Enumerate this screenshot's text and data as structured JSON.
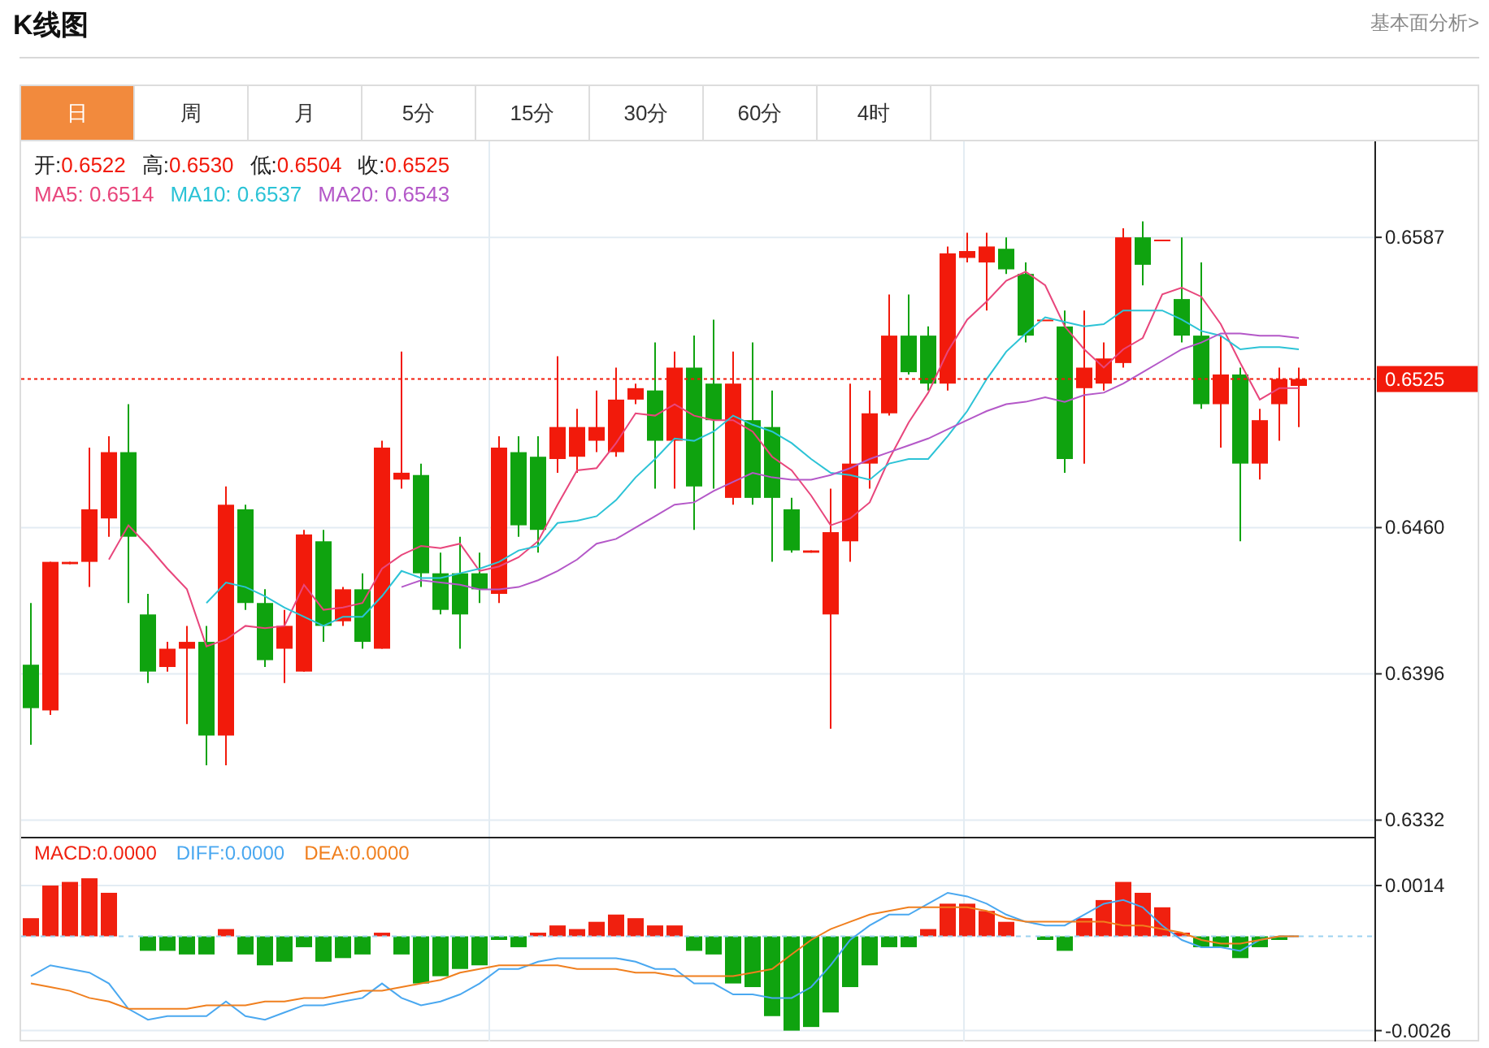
{
  "header": {
    "title": "K线图",
    "link": "基本面分析>"
  },
  "tabs": [
    {
      "label": "日",
      "selected": true
    },
    {
      "label": "周",
      "selected": false
    },
    {
      "label": "月",
      "selected": false
    },
    {
      "label": "5分",
      "selected": false
    },
    {
      "label": "15分",
      "selected": false
    },
    {
      "label": "30分",
      "selected": false
    },
    {
      "label": "60分",
      "selected": false
    },
    {
      "label": "4时",
      "selected": false
    }
  ],
  "ohlc_legend": [
    {
      "label": "开:",
      "value": "0.6522"
    },
    {
      "label": "高:",
      "value": "0.6530"
    },
    {
      "label": "低:",
      "value": "0.6504"
    },
    {
      "label": "收:",
      "value": "0.6525"
    }
  ],
  "ma_legend": [
    {
      "label": "MA5: 0.6514",
      "color": "#e8467c"
    },
    {
      "label": "MA10: 0.6537",
      "color": "#2cc3d6"
    },
    {
      "label": "MA20: 0.6543",
      "color": "#b458c8"
    }
  ],
  "price_chart": {
    "chart_data": {
      "type": "candlestick",
      "grid": true,
      "ylim": [
        0.6324,
        0.6629
      ],
      "yticks": [
        0.6332,
        0.6396,
        {
          "value": 0.646,
          "label": "0.6460"
        },
        0.6587
      ],
      "categories": [
        null,
        null,
        null,
        null,
        null,
        null,
        null,
        null,
        null,
        null,
        null,
        null,
        null,
        null,
        null,
        null,
        null,
        null,
        null,
        null,
        null,
        null,
        null,
        null,
        null,
        null,
        null,
        null,
        null,
        null,
        null,
        null,
        null,
        null,
        null,
        null,
        null,
        null,
        null,
        null,
        null,
        null,
        null,
        null,
        null,
        null,
        null,
        null,
        null,
        null,
        null,
        null,
        null,
        null,
        null,
        null,
        null,
        null,
        null,
        null,
        null,
        null,
        null,
        null,
        null,
        null
      ],
      "ref_lines": [
        {
          "axis": "y",
          "value": 0.6525,
          "label": "0.6525"
        }
      ],
      "ohlc": [
        [
          0.64,
          0.6427,
          0.6365,
          0.6381
        ],
        [
          0.638,
          0.6445,
          0.6378,
          0.6445
        ],
        [
          0.6444,
          0.6445,
          0.6444,
          0.6445
        ],
        [
          0.6445,
          0.6495,
          0.6434,
          0.6468
        ],
        [
          0.6464,
          0.65,
          0.6456,
          0.6493
        ],
        [
          0.6493,
          0.6514,
          0.6427,
          0.6456
        ],
        [
          0.6422,
          0.6431,
          0.6392,
          0.6397
        ],
        [
          0.6399,
          0.641,
          0.6397,
          0.6407
        ],
        [
          0.6407,
          0.6417,
          0.6374,
          0.641
        ],
        [
          0.641,
          0.6417,
          0.6356,
          0.6369
        ],
        [
          0.6369,
          0.6478,
          0.6356,
          0.647
        ],
        [
          0.6468,
          0.647,
          0.6424,
          0.6427
        ],
        [
          0.6427,
          0.6433,
          0.6399,
          0.6402
        ],
        [
          0.6407,
          0.6424,
          0.6392,
          0.6417
        ],
        [
          0.6397,
          0.6459,
          0.6397,
          0.6457
        ],
        [
          0.6454,
          0.6459,
          0.641,
          0.6417
        ],
        [
          0.6419,
          0.6434,
          0.6417,
          0.6433
        ],
        [
          0.6433,
          0.644,
          0.6407,
          0.641
        ],
        [
          0.6407,
          0.6498,
          0.6407,
          0.6495
        ],
        [
          0.6481,
          0.6537,
          0.6477,
          0.6484
        ],
        [
          0.6483,
          0.6488,
          0.6434,
          0.644
        ],
        [
          0.644,
          0.6449,
          0.6422,
          0.6424
        ],
        [
          0.644,
          0.6456,
          0.6407,
          0.6422
        ],
        [
          0.644,
          0.6449,
          0.6427,
          0.6433
        ],
        [
          0.6431,
          0.65,
          0.6427,
          0.6495
        ],
        [
          0.6493,
          0.65,
          0.6456,
          0.6461
        ],
        [
          0.6491,
          0.65,
          0.6449,
          0.6459
        ],
        [
          0.649,
          0.6535,
          0.6484,
          0.6504
        ],
        [
          0.6491,
          0.6512,
          0.6484,
          0.6504
        ],
        [
          0.6498,
          0.652,
          0.6493,
          0.6504
        ],
        [
          0.6493,
          0.653,
          0.6491,
          0.6516
        ],
        [
          0.6516,
          0.6523,
          0.6514,
          0.6521
        ],
        [
          0.652,
          0.6541,
          0.6477,
          0.6498
        ],
        [
          0.6498,
          0.6537,
          0.6477,
          0.653
        ],
        [
          0.653,
          0.6544,
          0.6459,
          0.6478
        ],
        [
          0.6523,
          0.6551,
          0.6477,
          0.6507
        ],
        [
          0.6473,
          0.6537,
          0.647,
          0.6523
        ],
        [
          0.6507,
          0.6541,
          0.647,
          0.6473
        ],
        [
          0.6504,
          0.652,
          0.6445,
          0.6473
        ],
        [
          0.6468,
          0.6473,
          0.6449,
          0.645
        ],
        [
          0.6449,
          0.645,
          0.6449,
          0.645
        ],
        [
          0.6422,
          0.6477,
          0.6372,
          0.6458
        ],
        [
          0.6454,
          0.6523,
          0.6445,
          0.6488
        ],
        [
          0.6488,
          0.652,
          0.6477,
          0.651
        ],
        [
          0.651,
          0.6562,
          0.6509,
          0.6544
        ],
        [
          0.6544,
          0.6562,
          0.6527,
          0.6528
        ],
        [
          0.6544,
          0.6548,
          0.652,
          0.6523
        ],
        [
          0.6523,
          0.6583,
          0.652,
          0.658
        ],
        [
          0.6578,
          0.6589,
          0.6576,
          0.6581
        ],
        [
          0.6576,
          0.6589,
          0.6555,
          0.6583
        ],
        [
          0.6582,
          0.6587,
          0.6571,
          0.6573
        ],
        [
          0.6571,
          0.6576,
          0.6541,
          0.6544
        ],
        [
          0.6551,
          0.6551,
          0.6551,
          0.6551
        ],
        [
          0.6548,
          0.6555,
          0.6484,
          0.649
        ],
        [
          0.6521,
          0.6555,
          0.6488,
          0.653
        ],
        [
          0.6523,
          0.6541,
          0.652,
          0.6534
        ],
        [
          0.6532,
          0.6591,
          0.653,
          0.6587
        ],
        [
          0.6587,
          0.6594,
          0.6566,
          0.6575
        ],
        [
          0.6586,
          0.6586,
          0.6586,
          0.6586
        ],
        [
          0.656,
          0.6587,
          0.6541,
          0.6544
        ],
        [
          0.6544,
          0.6576,
          0.6512,
          0.6514
        ],
        [
          0.6514,
          0.6544,
          0.6495,
          0.6527
        ],
        [
          0.6527,
          0.653,
          0.6454,
          0.6488
        ],
        [
          0.6488,
          0.6512,
          0.6481,
          0.6507
        ],
        [
          0.6514,
          0.653,
          0.6498,
          0.6525
        ],
        [
          0.6522,
          0.653,
          0.6504,
          0.6525
        ]
      ],
      "series": [
        {
          "type": "line",
          "color": "#e8467c",
          "values": [
            null,
            null,
            null,
            null,
            0.6446,
            0.6461,
            0.6452,
            0.6442,
            0.6433,
            0.6408,
            0.6411,
            0.6417,
            0.6416,
            0.6417,
            0.6435,
            0.6424,
            0.6425,
            0.6427,
            0.6442,
            0.6448,
            0.6452,
            0.6451,
            0.6453,
            0.6441,
            0.6443,
            0.6447,
            0.6454,
            0.647,
            0.6485,
            0.6486,
            0.6497,
            0.651,
            0.6509,
            0.6514,
            0.6509,
            0.6507,
            0.6507,
            0.6502,
            0.6491,
            0.6485,
            0.6474,
            0.6461,
            0.6464,
            0.6471,
            0.649,
            0.6506,
            0.6519,
            0.6537,
            0.6551,
            0.6559,
            0.6568,
            0.6572,
            0.6566,
            0.6548,
            0.6538,
            0.653,
            0.6538,
            0.6543,
            0.6562,
            0.6565,
            0.6561,
            0.6549,
            0.6532,
            0.6516,
            0.6521,
            0.6521
          ]
        },
        {
          "type": "line",
          "color": "#2cc3d6",
          "values": [
            null,
            null,
            null,
            null,
            null,
            null,
            null,
            null,
            null,
            0.6427,
            0.6436,
            0.6434,
            0.643,
            0.6425,
            0.6421,
            0.6417,
            0.6421,
            0.6421,
            0.643,
            0.6441,
            0.6438,
            0.6438,
            0.644,
            0.6442,
            0.6445,
            0.645,
            0.6452,
            0.6462,
            0.6463,
            0.6465,
            0.6472,
            0.6482,
            0.649,
            0.6499,
            0.6498,
            0.6502,
            0.6509,
            0.6505,
            0.6502,
            0.6497,
            0.649,
            0.6484,
            0.6483,
            0.6481,
            0.6488,
            0.649,
            0.649,
            0.65,
            0.6511,
            0.6525,
            0.6537,
            0.6545,
            0.6552,
            0.655,
            0.6548,
            0.6549,
            0.6555,
            0.6555,
            0.6555,
            0.6551,
            0.6546,
            0.6544,
            0.6538,
            0.6539,
            0.6539,
            0.6538
          ]
        },
        {
          "type": "line",
          "color": "#b458c8",
          "values": [
            null,
            null,
            null,
            null,
            null,
            null,
            null,
            null,
            null,
            null,
            null,
            null,
            null,
            null,
            null,
            null,
            null,
            null,
            null,
            0.6434,
            0.6437,
            0.6436,
            0.6435,
            0.6433,
            0.6433,
            0.6434,
            0.6437,
            0.6441,
            0.6446,
            0.6453,
            0.6455,
            0.646,
            0.6465,
            0.647,
            0.6471,
            0.6476,
            0.648,
            0.6484,
            0.6482,
            0.6481,
            0.6481,
            0.6483,
            0.6486,
            0.649,
            0.6493,
            0.6496,
            0.6499,
            0.6503,
            0.6507,
            0.6511,
            0.6514,
            0.6515,
            0.6517,
            0.6515,
            0.6518,
            0.6519,
            0.6523,
            0.6528,
            0.6533,
            0.6538,
            0.6541,
            0.6545,
            0.6545,
            0.6544,
            0.6544,
            0.6543
          ]
        }
      ]
    }
  },
  "macd_legend": [
    {
      "label": "MACD:0.0000",
      "color": "#f0200f"
    },
    {
      "label": "DIFF:0.0000",
      "color": "#4aa8f0"
    },
    {
      "label": "DEA:0.0000",
      "color": "#f07f1e"
    }
  ],
  "macd_chart": {
    "chart_data": {
      "type": "bar",
      "grid": true,
      "ylim": [
        -0.0029,
        0.0027
      ],
      "yticks": [
        -0.0026,
        0.0014
      ],
      "categories": [
        null,
        null,
        null,
        null,
        null,
        null,
        null,
        null,
        null,
        null,
        null,
        null,
        null,
        null,
        null,
        null,
        null,
        null,
        null,
        null,
        null,
        null,
        null,
        null,
        null,
        null,
        null,
        null,
        null,
        null,
        null,
        null,
        null,
        null,
        null,
        null,
        null,
        null,
        null,
        null,
        null,
        null,
        null,
        null,
        null,
        null,
        null,
        null,
        null,
        null,
        null,
        null,
        null,
        null,
        null,
        null,
        null,
        null,
        null,
        null,
        null,
        null,
        null,
        null,
        null,
        null
      ],
      "ref_lines": [
        {
          "axis": "y",
          "value": 0
        }
      ],
      "series": [
        {
          "color": "#f0200f",
          "values": [
            0.0005,
            0.0014,
            0.0015,
            0.0016,
            0.0012,
            null,
            null,
            null,
            null,
            null,
            0.0002,
            null,
            null,
            null,
            null,
            null,
            null,
            null,
            0.0001,
            null,
            null,
            null,
            null,
            null,
            null,
            null,
            0.0001,
            0.0003,
            0.0002,
            0.0004,
            0.0006,
            0.0005,
            0.0003,
            0.0003,
            null,
            null,
            null,
            null,
            null,
            null,
            null,
            null,
            null,
            null,
            null,
            null,
            0.0002,
            0.0009,
            0.0009,
            0.0007,
            0.0004,
            null,
            null,
            null,
            0.0005,
            0.001,
            0.0015,
            0.0012,
            0.0008,
            0.0001,
            null,
            null,
            null,
            null,
            null,
            null
          ]
        },
        {
          "color": "#0fa30f",
          "values": [
            null,
            null,
            null,
            null,
            null,
            null,
            -0.0004,
            -0.0004,
            -0.0005,
            -0.0005,
            null,
            -0.0005,
            -0.0008,
            -0.0007,
            -0.0003,
            -0.0007,
            -0.0006,
            -0.0005,
            null,
            -0.0005,
            -0.0013,
            -0.0011,
            -0.0009,
            -0.0008,
            -0.0001,
            -0.0003,
            null,
            null,
            null,
            null,
            null,
            null,
            null,
            null,
            -0.0004,
            -0.0005,
            -0.0013,
            -0.0014,
            -0.0022,
            -0.0026,
            -0.0025,
            -0.0021,
            -0.0014,
            -0.0008,
            -0.0003,
            -0.0003,
            null,
            null,
            null,
            null,
            null,
            null,
            -0.0001,
            -0.0004,
            null,
            null,
            null,
            null,
            null,
            null,
            -0.0003,
            -0.0003,
            -0.0006,
            -0.0003,
            -0.0001,
            null
          ]
        },
        {
          "type": "line",
          "color": "#4aa8f0",
          "values": [
            -0.0011,
            -0.0008,
            -0.0009,
            -0.001,
            -0.0013,
            -0.002,
            -0.0023,
            -0.0022,
            -0.0022,
            -0.0022,
            -0.0018,
            -0.0022,
            -0.0023,
            -0.0021,
            -0.0019,
            -0.0019,
            -0.0018,
            -0.0017,
            -0.0013,
            -0.0017,
            -0.0019,
            -0.0018,
            -0.0016,
            -0.0013,
            -0.0009,
            -0.0009,
            -0.0007,
            -0.0006,
            -0.0006,
            -0.0006,
            -0.0006,
            -0.0007,
            -0.0009,
            -0.0009,
            -0.0013,
            -0.0013,
            -0.0016,
            -0.0016,
            -0.0017,
            -0.0017,
            -0.0014,
            -0.0008,
            -0.0001,
            0.0003,
            0.0006,
            0.0006,
            0.0009,
            0.0012,
            0.0011,
            0.0009,
            0.0006,
            0.0004,
            0.0003,
            0.0003,
            0.0006,
            0.0009,
            0.001,
            0.0008,
            0.0003,
            -0.0001,
            -0.0003,
            -0.0003,
            -0.0004,
            -0.0001,
            0,
            0
          ]
        },
        {
          "type": "line",
          "color": "#f07f1e",
          "values": [
            -0.0013,
            -0.0014,
            -0.0015,
            -0.0017,
            -0.0018,
            -0.002,
            -0.002,
            -0.002,
            -0.002,
            -0.0019,
            -0.0019,
            -0.0019,
            -0.0018,
            -0.0018,
            -0.0017,
            -0.0017,
            -0.0016,
            -0.0015,
            -0.0015,
            -0.0014,
            -0.0013,
            -0.0012,
            -0.001,
            -0.0009,
            -0.0008,
            -0.0008,
            -0.0008,
            -0.0008,
            -0.0009,
            -0.0009,
            -0.0009,
            -0.001,
            -0.001,
            -0.0011,
            -0.0011,
            -0.0011,
            -0.0011,
            -0.001,
            -0.0009,
            -0.0005,
            -0.0001,
            0.0002,
            0.0004,
            0.0006,
            0.0007,
            0.0008,
            0.0008,
            0.0008,
            0.0008,
            0.0007,
            0.0005,
            0.0004,
            0.0004,
            0.0004,
            0.0004,
            0.0004,
            0.0003,
            0.0003,
            0.0002,
            0.0001,
            -0.0001,
            -0.0002,
            -0.0002,
            -0.0001,
            0,
            0
          ]
        }
      ]
    }
  }
}
